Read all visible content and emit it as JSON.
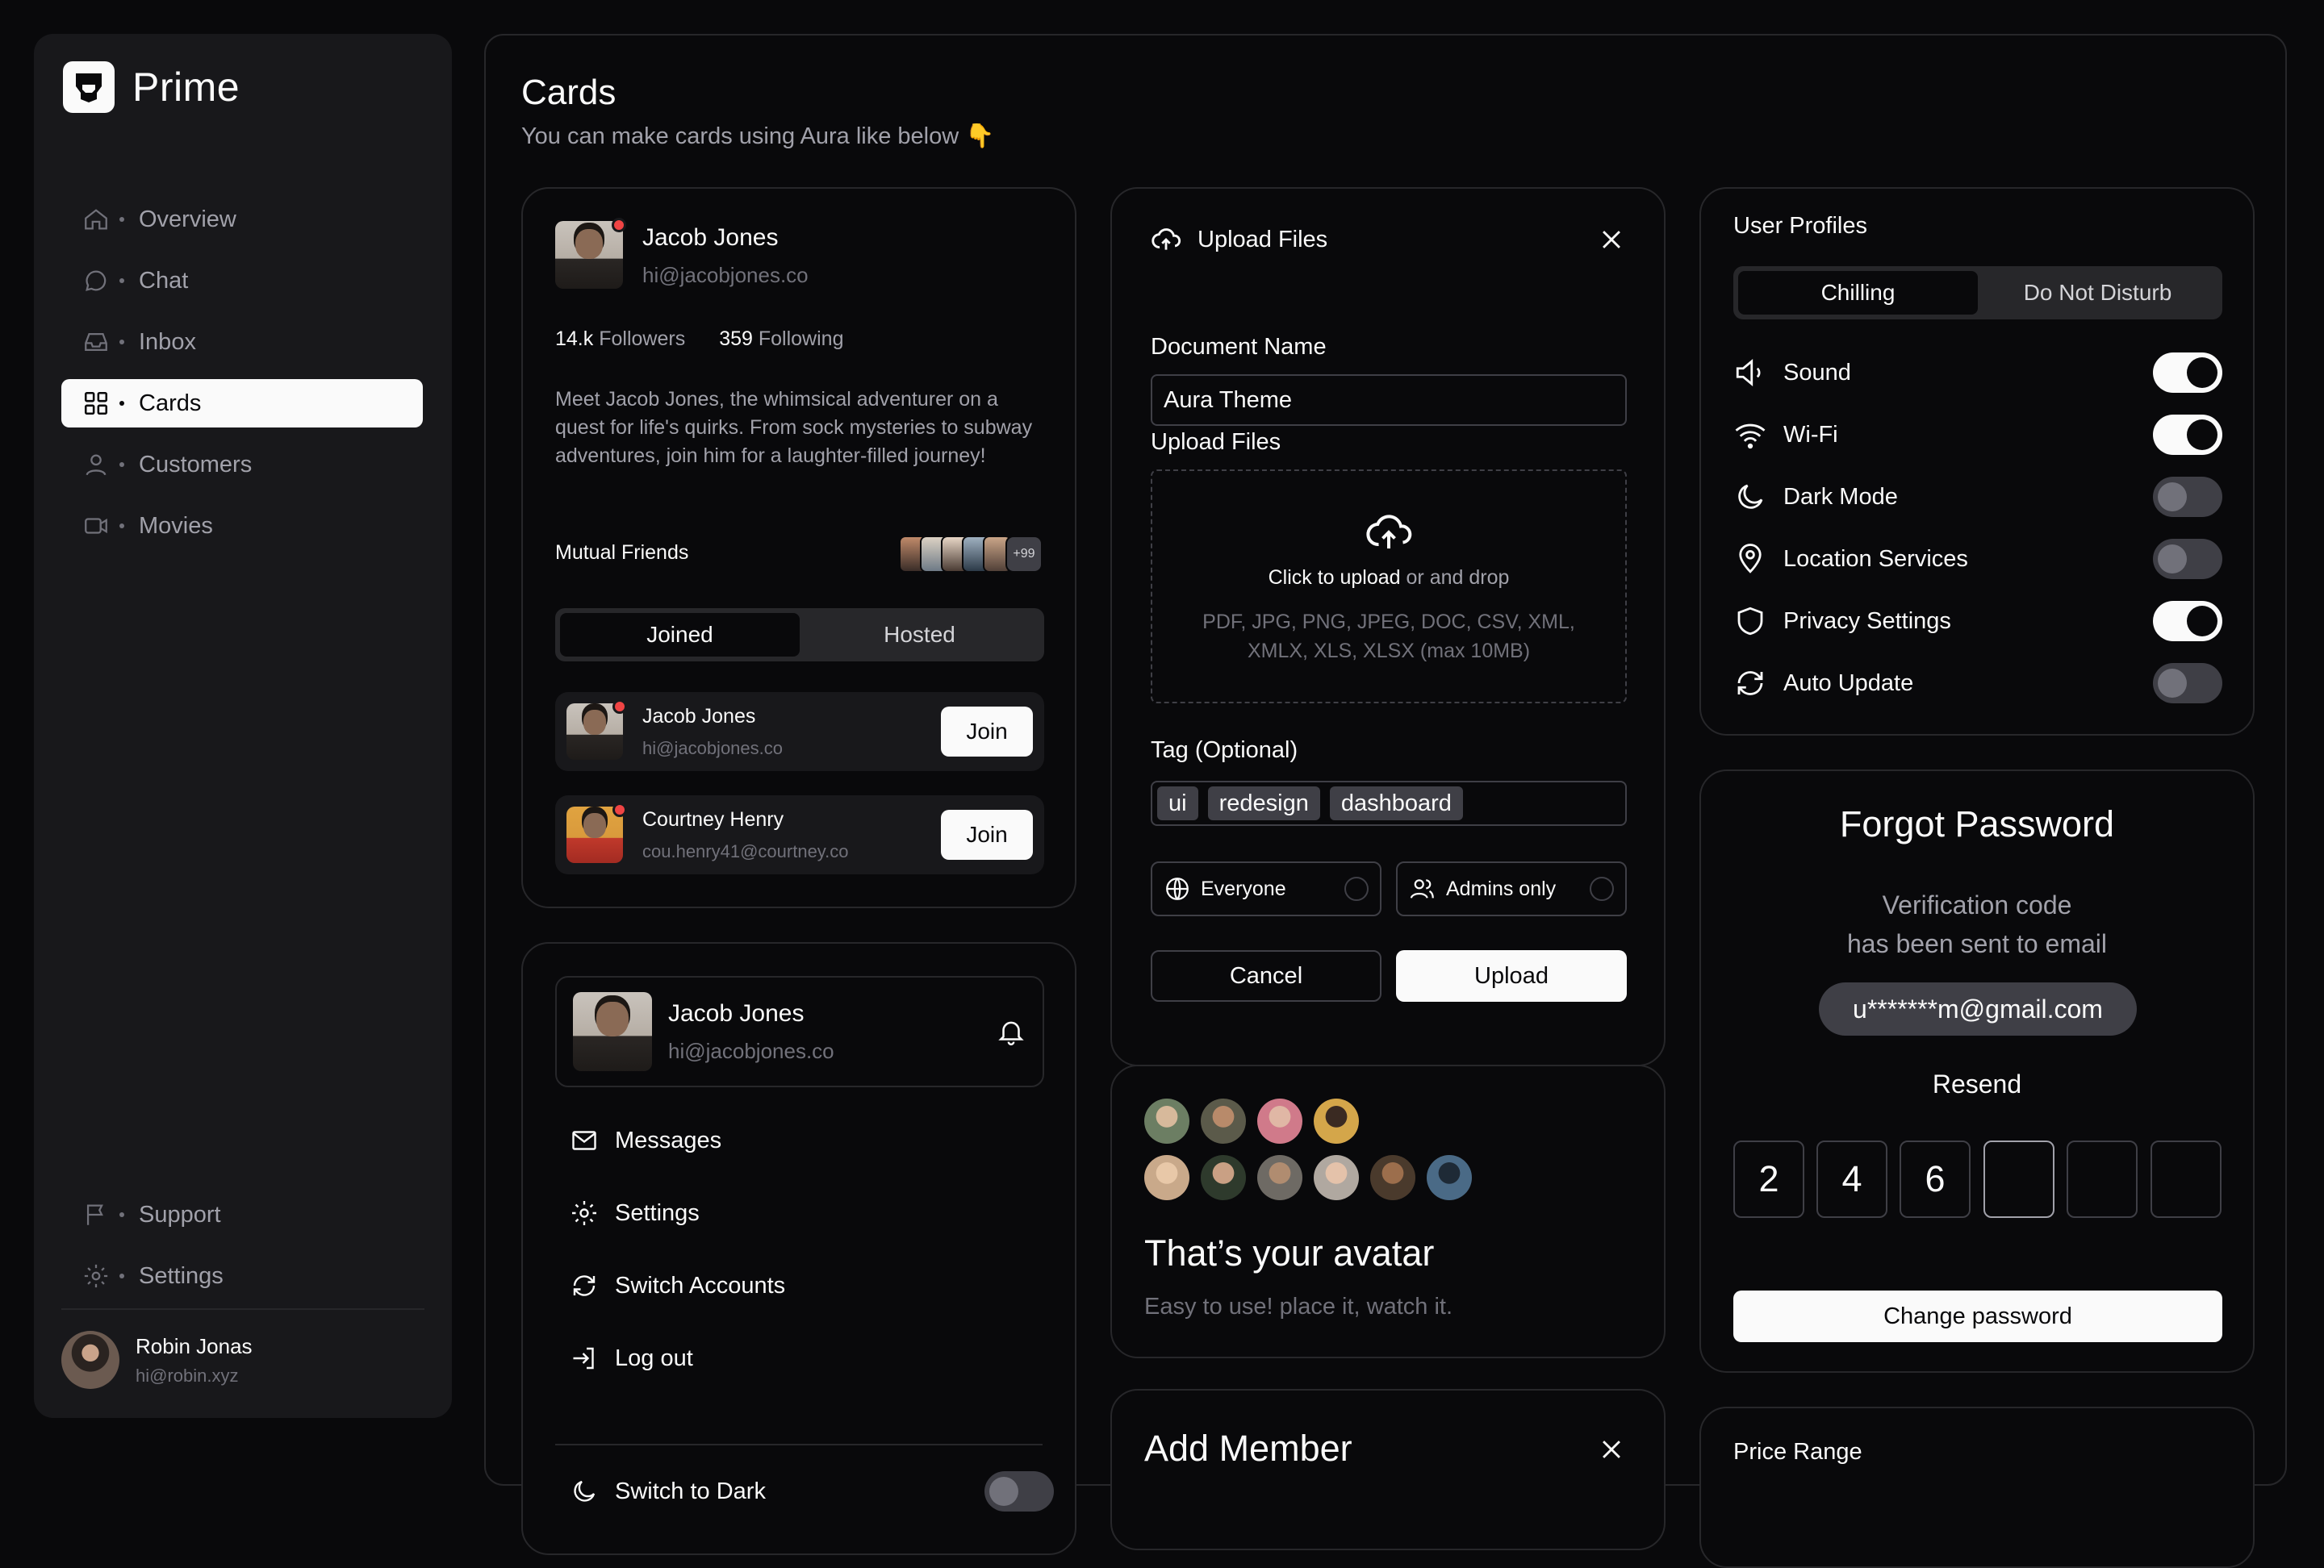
{
  "brand": {
    "name": "Prime"
  },
  "nav": [
    {
      "label": "Overview"
    },
    {
      "label": "Chat"
    },
    {
      "label": "Inbox"
    },
    {
      "label": "Cards"
    },
    {
      "label": "Customers"
    },
    {
      "label": "Movies"
    }
  ],
  "nav_bottom": [
    {
      "label": "Support"
    },
    {
      "label": "Settings"
    }
  ],
  "sidebar_user": {
    "name": "Robin Jonas",
    "email": "hi@robin.xyz"
  },
  "page": {
    "title": "Cards",
    "subtitle": "You can make cards using Aura like below 👇"
  },
  "profile_card": {
    "name": "Jacob Jones",
    "email": "hi@jacobjones.co",
    "followers_value": "14.k",
    "followers_label": "Followers",
    "following_value": "359",
    "following_label": "Following",
    "bio": "Meet Jacob Jones, the whimsical adventurer on a quest for life's quirks. From sock mysteries to subway adventures, join him for a laughter-filled journey!",
    "mutual_label": "Mutual Friends",
    "mutual_more": "+99",
    "tabs": [
      "Joined",
      "Hosted"
    ],
    "friends": [
      {
        "name": "Jacob Jones",
        "email": "hi@jacobjones.co",
        "action": "Join"
      },
      {
        "name": "Courtney Henry",
        "email": "cou.henry41@courtney.co",
        "action": "Join"
      }
    ]
  },
  "menu_card": {
    "name": "Jacob Jones",
    "email": "hi@jacobjones.co",
    "items": [
      {
        "label": "Messages"
      },
      {
        "label": "Settings"
      },
      {
        "label": "Switch Accounts"
      },
      {
        "label": "Log out"
      }
    ],
    "dark_label": "Switch to Dark"
  },
  "upload_card": {
    "title": "Upload Files",
    "doc_label": "Document Name",
    "doc_value": "Aura Theme",
    "files_label": "Upload Files",
    "drop_strong": "Click to upload",
    "drop_rest": " or and drop",
    "drop_formats": "PDF, JPG, PNG, JPEG, DOC, CSV, XML, XMLX, XLS, XLSX (max 10MB)",
    "tag_label": "Tag (Optional)",
    "tags": [
      "ui",
      "redesign",
      "dashboard"
    ],
    "options": [
      "Everyone",
      "Admins only"
    ],
    "cancel": "Cancel",
    "upload": "Upload"
  },
  "avatar_card": {
    "title": "That’s your avatar",
    "subtitle": "Easy to use! place it, watch it."
  },
  "add_member_card": {
    "title": "Add Member"
  },
  "user_profiles": {
    "title": "User Profiles",
    "tabs": [
      "Chilling",
      "Do Not Disturb"
    ],
    "settings": [
      {
        "label": "Sound",
        "on": true
      },
      {
        "label": "Wi-Fi",
        "on": true
      },
      {
        "label": "Dark Mode",
        "on": false
      },
      {
        "label": "Location Services",
        "on": false
      },
      {
        "label": "Privacy Settings",
        "on": true
      },
      {
        "label": "Auto Update",
        "on": false
      }
    ]
  },
  "forgot_password": {
    "title": "Forgot Password",
    "sub1": "Verification code",
    "sub2": "has been sent to email",
    "email": "u*******m@gmail.com",
    "resend": "Resend",
    "digits": [
      "2",
      "4",
      "6",
      "",
      "",
      ""
    ],
    "button": "Change password"
  },
  "price_range": {
    "title": "Price Range"
  },
  "colors": {
    "bg": "#09090b",
    "panel": "#18181b",
    "border": "#27272a",
    "text": "#fafafa",
    "muted": "#a1a1aa",
    "alert": "#ef4444"
  }
}
